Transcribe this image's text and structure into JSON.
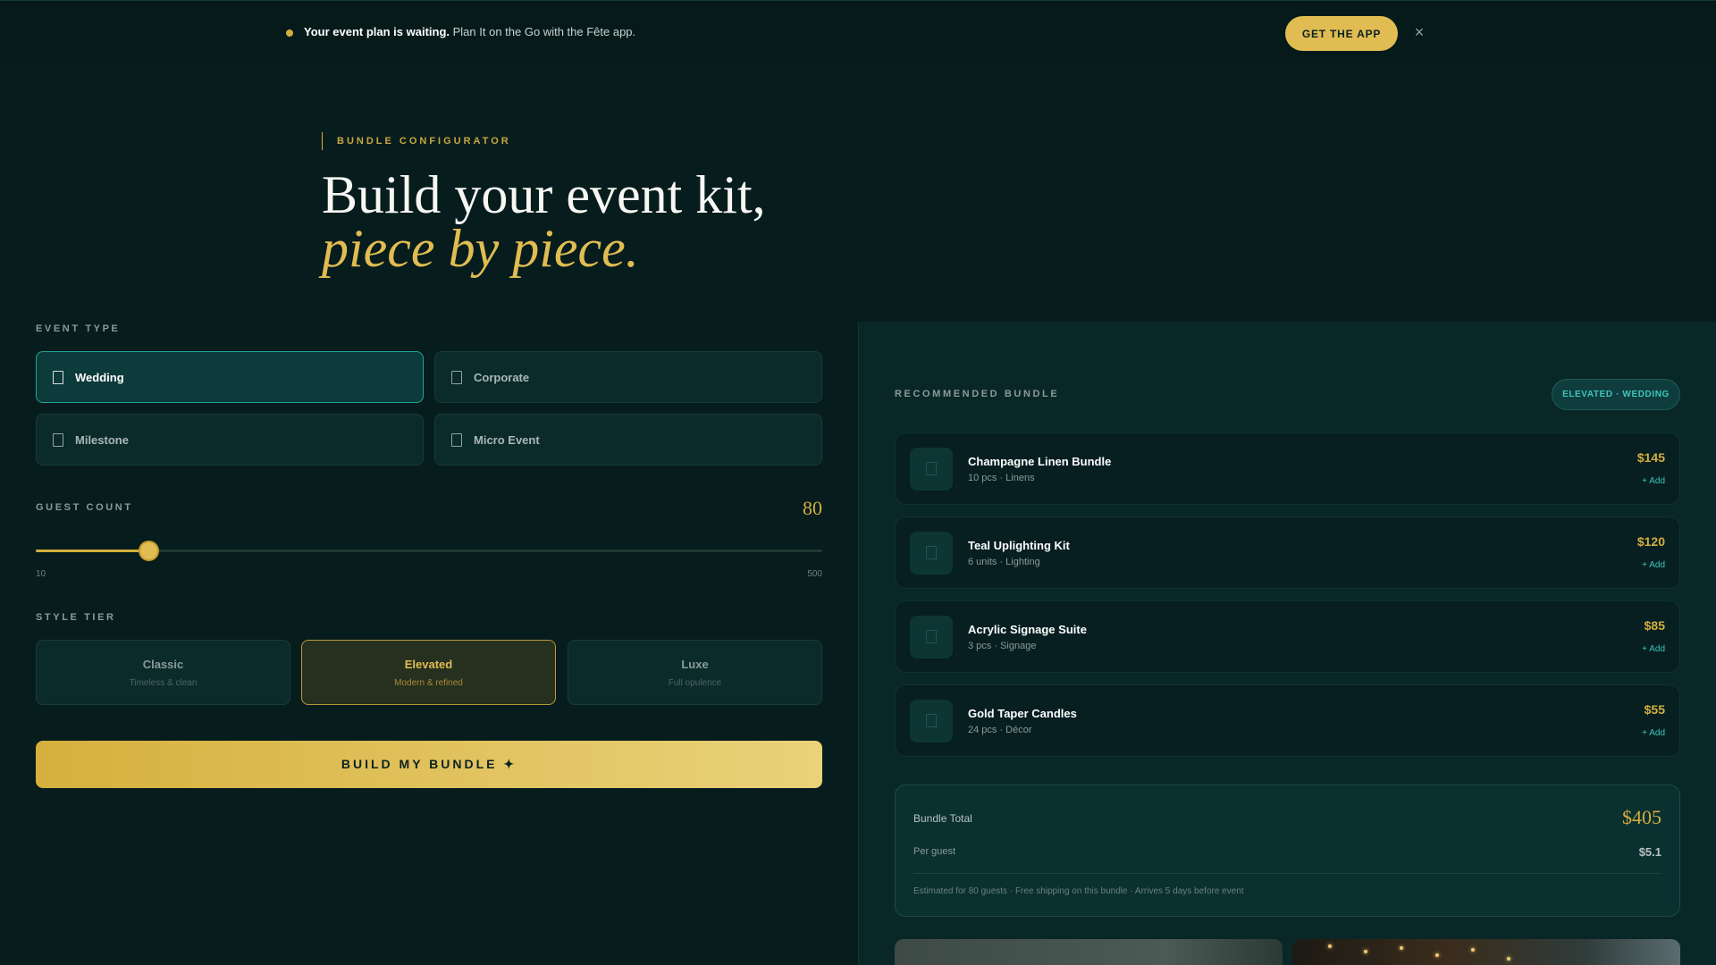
{
  "banner": {
    "headline": "Your event plan is waiting.",
    "message": " Plan It on the Go with the Fête app.",
    "cta_label": "GET THE APP",
    "close_glyph": "×"
  },
  "hero": {
    "eyebrow": "BUNDLE CONFIGURATOR",
    "title_line1": "Build your event kit,",
    "title_line2": "piece by piece."
  },
  "event_type": {
    "label": "EVENT TYPE",
    "selected": "Wedding",
    "options": [
      {
        "label": "Wedding",
        "icon": "document-icon"
      },
      {
        "label": "Corporate",
        "icon": "document-icon"
      },
      {
        "label": "Milestone",
        "icon": "document-icon"
      },
      {
        "label": "Micro Event",
        "icon": "document-icon"
      }
    ]
  },
  "guest_count": {
    "label": "GUEST COUNT",
    "value": "80",
    "value_number": 80,
    "min": 10,
    "max": 500,
    "min_label": "10",
    "max_label": "500"
  },
  "style_tier": {
    "label": "STYLE TIER",
    "selected": "Elevated",
    "options": [
      {
        "name": "Classic",
        "subtitle": "Timeless & clean"
      },
      {
        "name": "Elevated",
        "subtitle": "Modern & refined"
      },
      {
        "name": "Luxe",
        "subtitle": "Full opulence"
      }
    ]
  },
  "build_button": {
    "label": "BUILD MY BUNDLE ✦"
  },
  "bundle": {
    "label": "RECOMMENDED BUNDLE",
    "badge": "ELEVATED · WEDDING",
    "items": [
      {
        "name": "Champagne Linen Bundle",
        "meta": "10 pcs · Linens",
        "price": "$145",
        "add": "+ Add"
      },
      {
        "name": "Teal Uplighting Kit",
        "meta": "6 units · Lighting",
        "price": "$120",
        "add": "+ Add"
      },
      {
        "name": "Acrylic Signage Suite",
        "meta": "3 pcs · Signage",
        "price": "$85",
        "add": "+ Add"
      },
      {
        "name": "Gold Taper Candles",
        "meta": "24 pcs · Décor",
        "price": "$55",
        "add": "+ Add"
      }
    ],
    "total_label": "Bundle Total",
    "total_value": "$405",
    "per_guest_label": "Per guest",
    "per_guest_value": "$5.1",
    "note": "Estimated for 80 guests · Free shipping on this bundle · Arrives 5 days before event"
  },
  "colors": {
    "background": "#071c1c",
    "accent_gold": "#d4ae3e",
    "accent_teal": "#3fc4bb"
  }
}
